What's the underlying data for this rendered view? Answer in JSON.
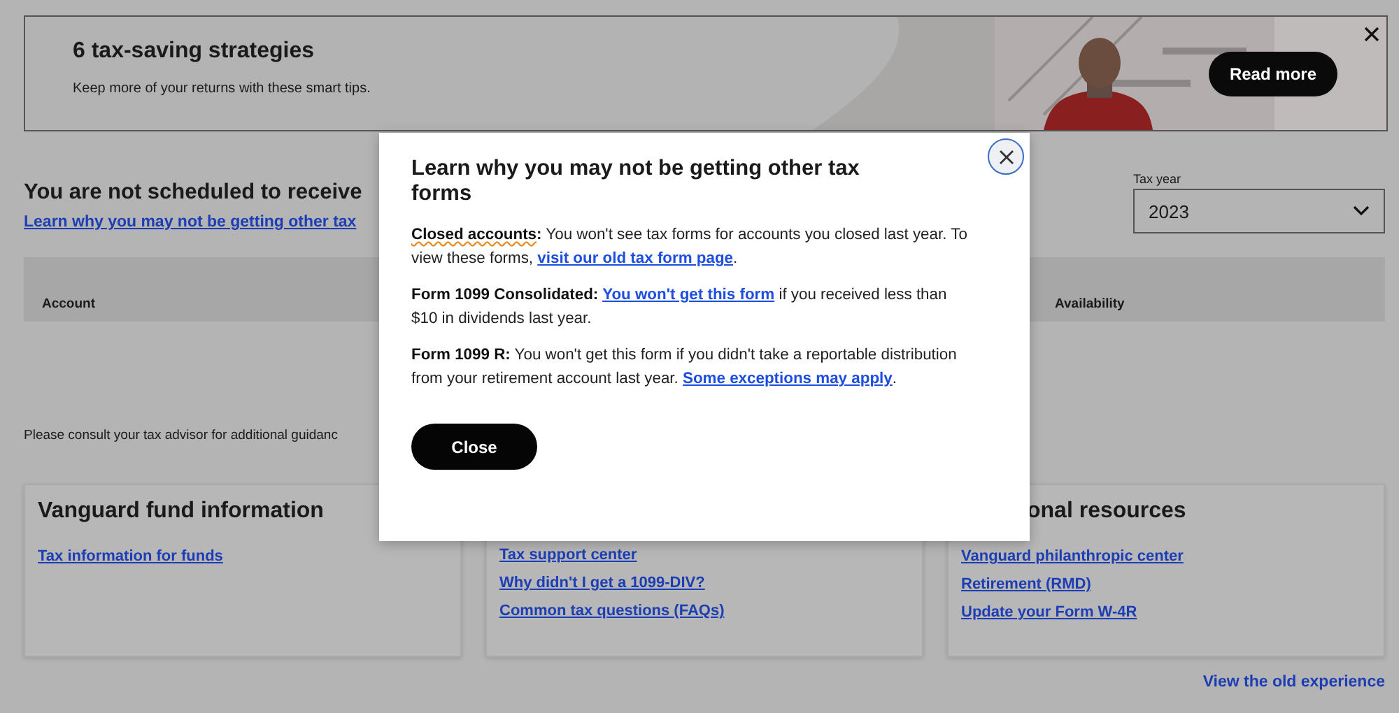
{
  "banner": {
    "title": "6 tax-saving strategies",
    "subtitle": "Keep more of your returns with these smart tips.",
    "button": "Read more"
  },
  "summary": {
    "heading": "You are not scheduled to receive",
    "link": "Learn why you may not be getting other tax",
    "tax_year": {
      "label": "Tax year",
      "value": "2023"
    },
    "table": {
      "columns": [
        "Account",
        "Availability"
      ]
    },
    "note": "Please consult your tax advisor for additional guidanc"
  },
  "cards": [
    {
      "title": "Vanguard fund information",
      "links": [
        "Tax information for funds"
      ]
    },
    {
      "links": [
        "Tax support center",
        "Why didn't I get a 1099-DIV?",
        "Common tax questions (FAQs)"
      ]
    },
    {
      "title": "onal resources",
      "links": [
        "Vanguard philanthropic center",
        "Retirement (RMD)",
        "Update your Form W-4R"
      ]
    }
  ],
  "footer_link": "View the old experience",
  "modal": {
    "title": "Learn why you may not be getting other tax forms",
    "paragraphs": [
      [
        {
          "kind": "bold",
          "text": "Closed accounts",
          "flagged": true
        },
        {
          "kind": "bold",
          "text": ":",
          "flagged": false
        },
        {
          "kind": "plain",
          "text": " You won't see tax forms for accounts you closed last year. To view these forms, ",
          "flagged": false
        },
        {
          "kind": "link",
          "text": "visit our old tax form page",
          "flagged": false
        },
        {
          "kind": "plain",
          "text": ".",
          "flagged": false
        }
      ],
      [
        {
          "kind": "bold",
          "text": "Form 1099 Consolidated: ",
          "flagged": false
        },
        {
          "kind": "link",
          "text": "You won't get this form",
          "flagged": false
        },
        {
          "kind": "plain",
          "text": " if you received less than $10 in dividends last year.",
          "flagged": false
        }
      ],
      [
        {
          "kind": "bold",
          "text": "Form 1099 R:",
          "flagged": false
        },
        {
          "kind": "plain",
          "text": " You won't get this form if you didn't take a reportable distribution from your retirement account last year. ",
          "flagged": false
        },
        {
          "kind": "link",
          "text": "Some exceptions ",
          "flagged": false
        },
        {
          "kind": "link",
          "text": "may apply",
          "flagged": false
        },
        {
          "kind": "plain",
          "text": ".",
          "flagged": false
        }
      ]
    ],
    "button": "Close"
  }
}
